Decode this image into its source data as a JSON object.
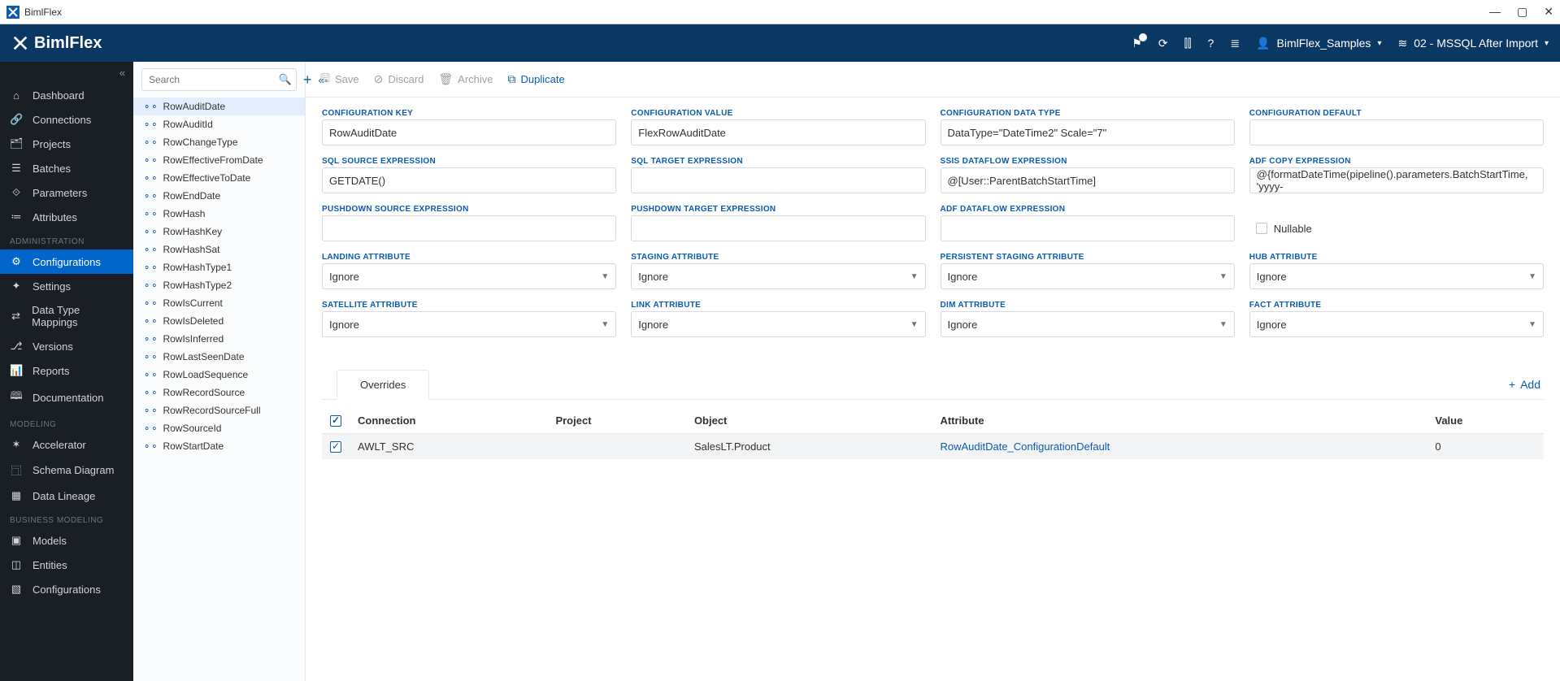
{
  "window": {
    "title": "BimlFlex"
  },
  "appbar": {
    "brand": "BimlFlex",
    "customer_label": "BimlFlex_Samples",
    "version_label": "02 - MSSQL After Import"
  },
  "sidebar": {
    "groups": [
      {
        "section": null,
        "items": [
          {
            "label": "Dashboard",
            "icon": "⌂"
          },
          {
            "label": "Connections",
            "icon": "🔗"
          },
          {
            "label": "Projects",
            "icon": "🗂"
          },
          {
            "label": "Batches",
            "icon": "☰"
          },
          {
            "label": "Parameters",
            "icon": "⟐"
          },
          {
            "label": "Attributes",
            "icon": "≔"
          }
        ]
      },
      {
        "section": "ADMINISTRATION",
        "items": [
          {
            "label": "Configurations",
            "icon": "⚙",
            "active": true
          },
          {
            "label": "Settings",
            "icon": "✦"
          },
          {
            "label": "Data Type Mappings",
            "icon": "⇄"
          },
          {
            "label": "Versions",
            "icon": "⎇"
          },
          {
            "label": "Reports",
            "icon": "📊"
          },
          {
            "label": "Documentation",
            "icon": "🕮"
          }
        ]
      },
      {
        "section": "MODELING",
        "items": [
          {
            "label": "Accelerator",
            "icon": "✶"
          },
          {
            "label": "Schema Diagram",
            "icon": "⿹"
          },
          {
            "label": "Data Lineage",
            "icon": "▦"
          }
        ]
      },
      {
        "section": "BUSINESS MODELING",
        "items": [
          {
            "label": "Models",
            "icon": "▣"
          },
          {
            "label": "Entities",
            "icon": "◫"
          },
          {
            "label": "Configurations",
            "icon": "▧"
          }
        ]
      }
    ]
  },
  "search": {
    "placeholder": "Search"
  },
  "config_list": [
    "RowAuditDate",
    "RowAuditId",
    "RowChangeType",
    "RowEffectiveFromDate",
    "RowEffectiveToDate",
    "RowEndDate",
    "RowHash",
    "RowHashKey",
    "RowHashSat",
    "RowHashType1",
    "RowHashType2",
    "RowIsCurrent",
    "RowIsDeleted",
    "RowIsInferred",
    "RowLastSeenDate",
    "RowLoadSequence",
    "RowRecordSource",
    "RowRecordSourceFull",
    "RowSourceId",
    "RowStartDate"
  ],
  "config_selected": 0,
  "toolbar": {
    "save": "Save",
    "discard": "Discard",
    "archive": "Archive",
    "duplicate": "Duplicate"
  },
  "form": {
    "configuration_key": {
      "label": "CONFIGURATION KEY",
      "value": "RowAuditDate"
    },
    "configuration_value": {
      "label": "CONFIGURATION VALUE",
      "value": "FlexRowAuditDate"
    },
    "configuration_data_type": {
      "label": "CONFIGURATION DATA TYPE",
      "value": "DataType=\"DateTime2\" Scale=\"7\""
    },
    "configuration_default": {
      "label": "CONFIGURATION DEFAULT",
      "value": ""
    },
    "sql_source_expression": {
      "label": "SQL SOURCE EXPRESSION",
      "value": "GETDATE()"
    },
    "sql_target_expression": {
      "label": "SQL TARGET EXPRESSION",
      "value": ""
    },
    "ssis_dataflow_expression": {
      "label": "SSIS DATAFLOW EXPRESSION",
      "value": "@[User::ParentBatchStartTime]"
    },
    "adf_copy_expression": {
      "label": "ADF COPY EXPRESSION",
      "value": "@{formatDateTime(pipeline().parameters.BatchStartTime, 'yyyy-"
    },
    "pushdown_source_expression": {
      "label": "PUSHDOWN SOURCE EXPRESSION",
      "value": ""
    },
    "pushdown_target_expression": {
      "label": "PUSHDOWN TARGET EXPRESSION",
      "value": ""
    },
    "adf_dataflow_expression": {
      "label": "ADF DATAFLOW EXPRESSION",
      "value": ""
    },
    "nullable": {
      "label": "Nullable",
      "checked": false
    },
    "landing_attribute": {
      "label": "LANDING ATTRIBUTE",
      "value": "Ignore"
    },
    "staging_attribute": {
      "label": "STAGING ATTRIBUTE",
      "value": "Ignore"
    },
    "persistent_staging_attribute": {
      "label": "PERSISTENT STAGING ATTRIBUTE",
      "value": "Ignore"
    },
    "hub_attribute": {
      "label": "HUB ATTRIBUTE",
      "value": "Ignore"
    },
    "satellite_attribute": {
      "label": "SATELLITE ATTRIBUTE",
      "value": "Ignore"
    },
    "link_attribute": {
      "label": "LINK ATTRIBUTE",
      "value": "Ignore"
    },
    "dim_attribute": {
      "label": "DIM ATTRIBUTE",
      "value": "Ignore"
    },
    "fact_attribute": {
      "label": "FACT ATTRIBUTE",
      "value": "Ignore"
    }
  },
  "tabs": {
    "overrides": "Overrides",
    "add": "Add"
  },
  "table": {
    "headers": {
      "connection": "Connection",
      "project": "Project",
      "object": "Object",
      "attribute": "Attribute",
      "value": "Value"
    },
    "rows": [
      {
        "checked": true,
        "connection": "AWLT_SRC",
        "project": "",
        "object": "SalesLT.Product",
        "attribute": "RowAuditDate_ConfigurationDefault",
        "value": "0"
      }
    ]
  }
}
